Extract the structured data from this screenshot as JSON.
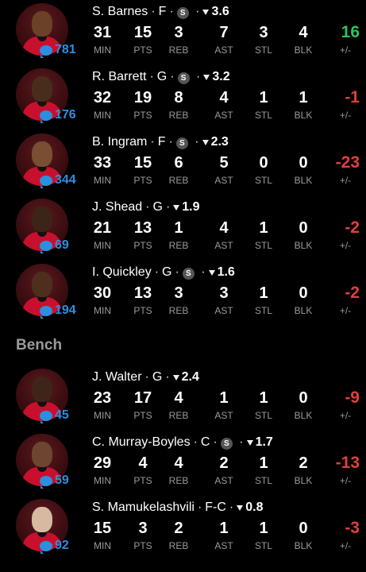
{
  "colors": {
    "positive": "#2ec55b",
    "negative": "#e0403b",
    "accent": "#2b8fe0"
  },
  "stat_labels": {
    "min": "MIN",
    "pts": "PTS",
    "reb": "REB",
    "ast": "AST",
    "stl": "STL",
    "blk": "BLK",
    "pm": "+/-"
  },
  "bench_label": "Bench",
  "starters": [
    {
      "name": "S. Barnes",
      "pos": "F",
      "starter_badge": "S",
      "rating": "3.6",
      "comments": "781",
      "min": "31",
      "pts": "15",
      "reb": "3",
      "ast": "7",
      "stl": "3",
      "blk": "4",
      "pm": "16",
      "pm_sign": "positive"
    },
    {
      "name": "R. Barrett",
      "pos": "G",
      "starter_badge": "S",
      "rating": "3.2",
      "comments": "176",
      "min": "32",
      "pts": "19",
      "reb": "8",
      "ast": "4",
      "stl": "1",
      "blk": "1",
      "pm": "-1",
      "pm_sign": "negative"
    },
    {
      "name": "B. Ingram",
      "pos": "F",
      "starter_badge": "S",
      "rating": "2.3",
      "comments": "344",
      "min": "33",
      "pts": "15",
      "reb": "6",
      "ast": "5",
      "stl": "0",
      "blk": "0",
      "pm": "-23",
      "pm_sign": "negative"
    },
    {
      "name": "J. Shead",
      "pos": "G",
      "starter_badge": "",
      "rating": "1.9",
      "comments": "69",
      "min": "21",
      "pts": "13",
      "reb": "1",
      "ast": "4",
      "stl": "1",
      "blk": "0",
      "pm": "-2",
      "pm_sign": "negative"
    },
    {
      "name": "I. Quickley",
      "pos": "G",
      "starter_badge": "S",
      "rating": "1.6",
      "comments": "194",
      "min": "30",
      "pts": "13",
      "reb": "3",
      "ast": "3",
      "stl": "1",
      "blk": "0",
      "pm": "-2",
      "pm_sign": "negative"
    }
  ],
  "bench": [
    {
      "name": "J. Walter",
      "pos": "G",
      "starter_badge": "",
      "rating": "2.4",
      "comments": "45",
      "min": "23",
      "pts": "17",
      "reb": "4",
      "ast": "1",
      "stl": "1",
      "blk": "0",
      "pm": "-9",
      "pm_sign": "negative"
    },
    {
      "name": "C. Murray-Boyles",
      "pos": "C",
      "starter_badge": "S",
      "rating": "1.7",
      "comments": "59",
      "min": "29",
      "pts": "4",
      "reb": "4",
      "ast": "2",
      "stl": "1",
      "blk": "2",
      "pm": "-13",
      "pm_sign": "negative"
    },
    {
      "name": "S. Mamukelashvili",
      "pos": "F-C",
      "starter_badge": "",
      "rating": "0.8",
      "comments": "92",
      "min": "15",
      "pts": "3",
      "reb": "2",
      "ast": "1",
      "stl": "1",
      "blk": "0",
      "pm": "-3",
      "pm_sign": "negative"
    }
  ],
  "avatar_skin_tones": [
    "#6b4128",
    "#4a2c1c",
    "#7a4e32",
    "#3d2418",
    "#4e2e1c",
    "#3f2519",
    "#6e4530",
    "#d7b8a0"
  ]
}
